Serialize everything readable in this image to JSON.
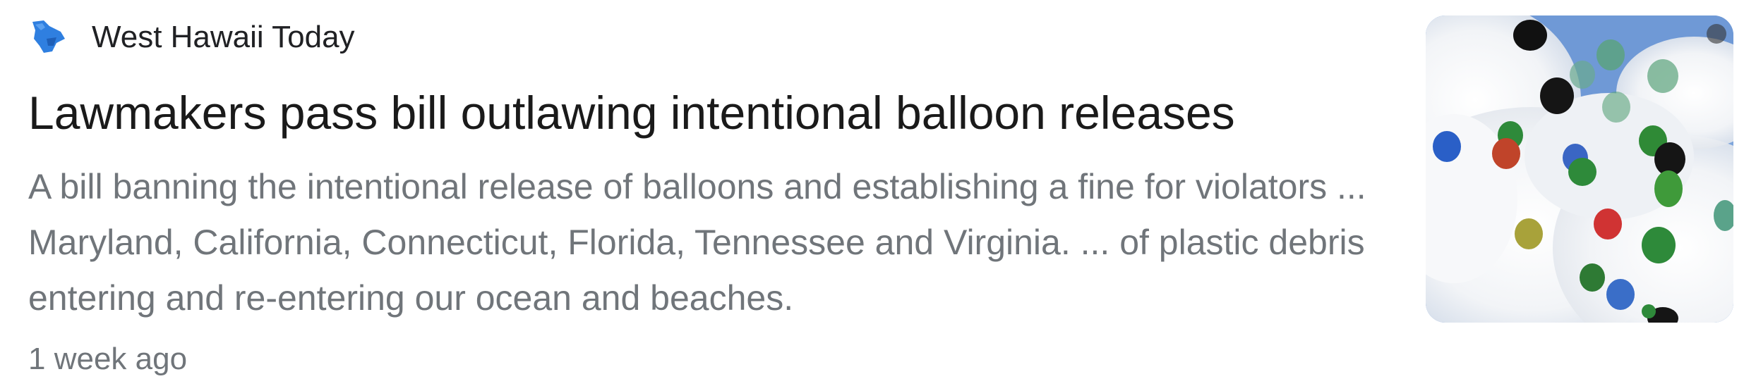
{
  "result": {
    "source": {
      "name": "West Hawaii Today",
      "icon": "hawaii-island-logo-icon",
      "icon_color": "#2f7fe0"
    },
    "headline": "Lawmakers pass bill outlawing intentional balloon releases",
    "snippet": "A bill banning the intentional release of balloons and establishing a fine for violators ... Maryland, California, Connecticut, Florida, Tennessee and Virginia. ... of plastic debris entering and re-entering our ocean and beaches.",
    "time": "1 week ago",
    "thumbnail": {
      "subject": "balloons-in-sky-image"
    }
  }
}
